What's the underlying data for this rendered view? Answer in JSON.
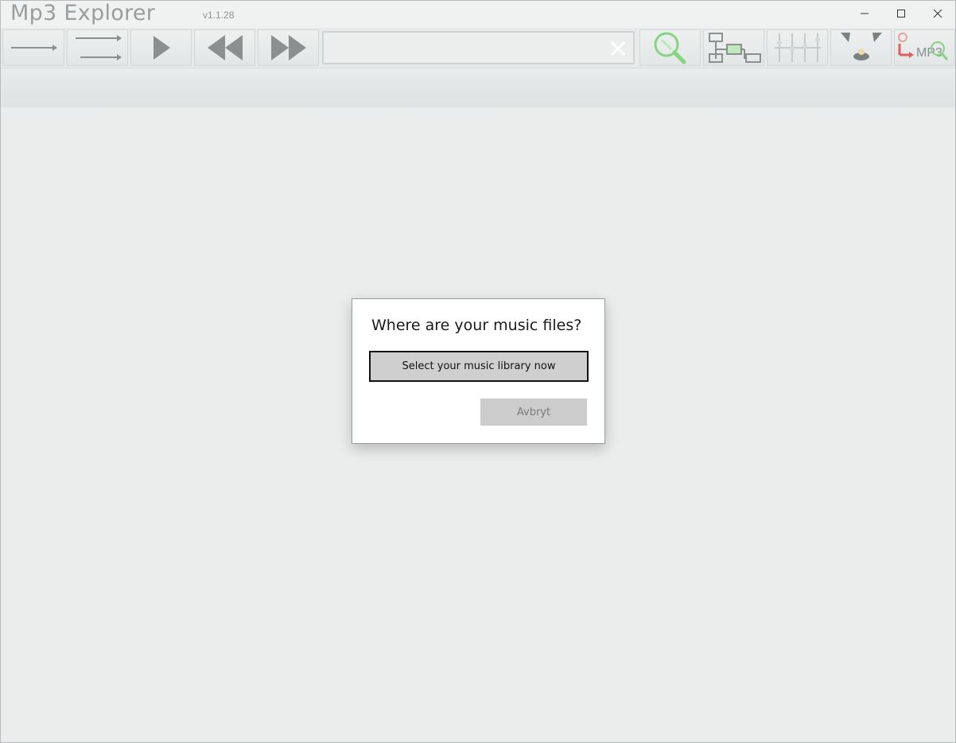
{
  "window": {
    "title": "Mp3 Explorer",
    "version": "v1.1.28"
  },
  "toolbar": {
    "buttons": [
      {
        "name": "play-next-icon"
      },
      {
        "name": "play-all-icon"
      },
      {
        "name": "play-icon"
      },
      {
        "name": "rewind-icon"
      },
      {
        "name": "fast-forward-icon"
      },
      {
        "name": "search-magnifier-icon"
      },
      {
        "name": "tree-view-icon"
      },
      {
        "name": "equalizer-icon"
      },
      {
        "name": "speakers-icon"
      },
      {
        "name": "mp3-logo-icon"
      }
    ],
    "search": {
      "value": "",
      "placeholder": ""
    },
    "mp3_logo_text": "MP3"
  },
  "dialog": {
    "title": "Where are your music files?",
    "primary_label": "Select your music library now",
    "cancel_label": "Avbryt"
  },
  "colors": {
    "icon_gray": "#8c8f90",
    "accent_green": "#7fd27a"
  }
}
